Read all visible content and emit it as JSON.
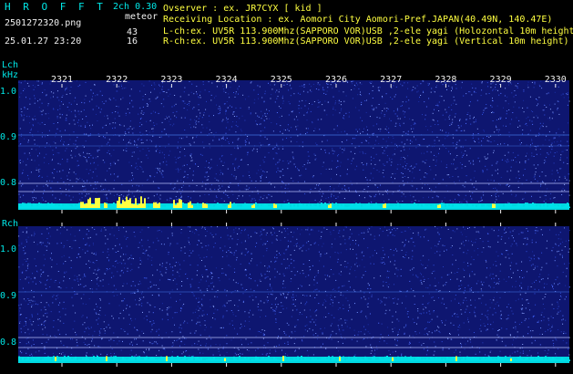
{
  "header": {
    "brand": "H R O F F T",
    "version": "2ch 0.30",
    "mode": "meteor",
    "filename": "2501272320.png",
    "datetime": "25.01.27 23:20",
    "count_l": "43",
    "count_r": "16",
    "observer": "Ovserver              : ex. JR7CYX [ kid ]",
    "location": "Receiving Location : ex. Aomori City Aomori-Pref.JAPAN(40.49N, 140.47E)",
    "lch_info": "L-ch:ex. UV5R 113.900Mhz(SAPPORO VOR)USB ,2-ele yagi (Holozontal 10m height",
    "rch_info": "R-ch:ex. UV5R 113.900Mhz(SAPPORO VOR)USB ,2-ele yagi (Vertical 10m height)"
  },
  "time_ticks": [
    "2321",
    "2322",
    "2323",
    "2324",
    "2325",
    "2326",
    "2327",
    "2328",
    "2329",
    "2330"
  ],
  "lch": {
    "label": "Lch",
    "unit": "kHz",
    "ticks": [
      "1.0",
      "0.9",
      "0.8"
    ]
  },
  "rch": {
    "label": "Rch",
    "ticks": [
      "1.0",
      "0.9",
      "0.8"
    ]
  },
  "colors": {
    "background": "#000000",
    "spectrum": "#101a80",
    "noise": "#00e8e8",
    "marker": "#ffff40"
  }
}
